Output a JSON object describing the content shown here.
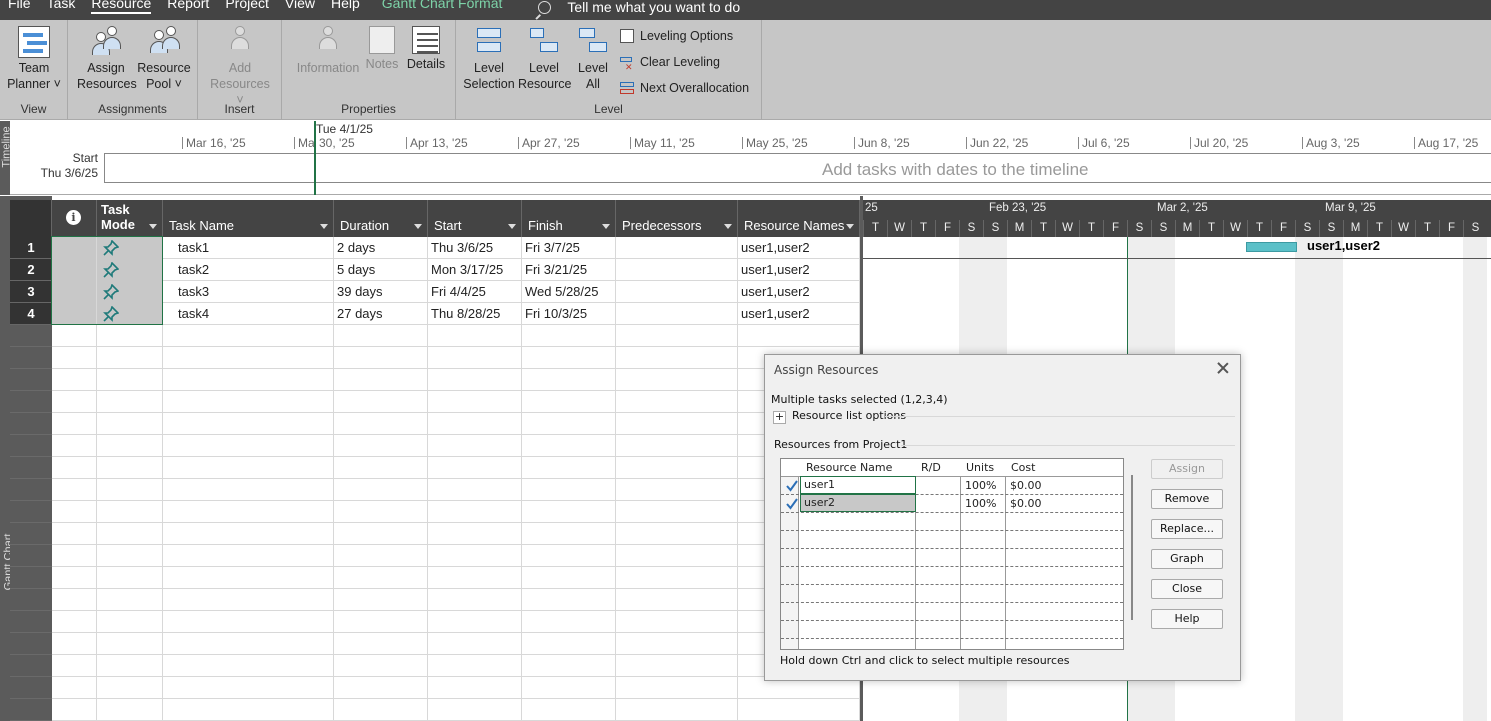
{
  "menu": {
    "tabs": [
      "File",
      "Task",
      "Resource",
      "Report",
      "Project",
      "View",
      "Help"
    ],
    "active": "Resource",
    "contextual_tab": "Gantt Chart Format",
    "search_placeholder": "Tell me what you want to do"
  },
  "ribbon": {
    "groups": {
      "view": "View",
      "assignments": "Assignments",
      "insert": "Insert",
      "properties": "Properties",
      "level": "Level"
    },
    "buttons": {
      "team_planner": [
        "Team",
        "Planner ˅"
      ],
      "assign_resources": [
        "Assign",
        "Resources"
      ],
      "resource_pool": [
        "Resource",
        "Pool ˅"
      ],
      "add_resources": [
        "Add",
        "Resources ˅"
      ],
      "information": "Information",
      "notes": "Notes",
      "details": "Details",
      "level_selection": [
        "Level",
        "Selection"
      ],
      "level_resource": [
        "Level",
        "Resource"
      ],
      "level_all": [
        "Level",
        "All"
      ],
      "leveling_options": "Leveling Options",
      "clear_leveling": "Clear Leveling",
      "next_overallocation": "Next Overallocation"
    }
  },
  "timeline": {
    "side_label": "Timeline",
    "start_label": "Start",
    "start_date": "Thu 3/6/25",
    "today_label": "Tue 4/1/25",
    "placeholder": "Add tasks with dates to the timeline",
    "dates": [
      "Mar 16, '25",
      "Ma",
      "30, '25",
      "Apr 13, '25",
      "Apr 27, '25",
      "May 11, '25",
      "May 25, '25",
      "Jun 8, '25",
      "Jun 22, '25",
      "Jul 6, '25",
      "Jul 20, '25",
      "Aug 3, '25",
      "Aug 17, '25"
    ]
  },
  "grid": {
    "side_label": "Gantt Chart",
    "headers": {
      "task_mode": [
        "Task",
        "Mode"
      ],
      "task_name": "Task Name",
      "duration": "Duration",
      "start": "Start",
      "finish": "Finish",
      "predecessors": "Predecessors",
      "resource_names": "Resource Names"
    },
    "rows": [
      {
        "id": "1",
        "name": "task1",
        "duration": "2 days",
        "start": "Thu 3/6/25",
        "finish": "Fri 3/7/25",
        "predecessors": "",
        "resources": "user1,user2"
      },
      {
        "id": "2",
        "name": "task2",
        "duration": "5 days",
        "start": "Mon 3/17/25",
        "finish": "Fri 3/21/25",
        "predecessors": "",
        "resources": "user1,user2"
      },
      {
        "id": "3",
        "name": "task3",
        "duration": "39 days",
        "start": "Fri 4/4/25",
        "finish": "Wed 5/28/25",
        "predecessors": "",
        "resources": "user1,user2"
      },
      {
        "id": "4",
        "name": "task4",
        "duration": "27 days",
        "start": "Thu 8/28/25",
        "finish": "Fri 10/3/25",
        "predecessors": "",
        "resources": "user1,user2"
      }
    ]
  },
  "gantt": {
    "weeks": [
      "25",
      "Feb 23, '25",
      "Mar 2, '25",
      "Mar 9, '25"
    ],
    "days": [
      "T",
      "W",
      "T",
      "F",
      "S",
      "S",
      "M",
      "T",
      "W",
      "T",
      "F",
      "S",
      "S",
      "M",
      "T",
      "W",
      "T",
      "F",
      "S",
      "S",
      "M",
      "T",
      "W",
      "T",
      "F",
      "S"
    ],
    "bar_label": "user1,user2",
    "colors": {
      "bar": "#5bc0c8",
      "today": "#217346"
    }
  },
  "dialog": {
    "title": "Assign Resources",
    "selection_text": "Multiple tasks selected (1,2,3,4)",
    "list_options": "Resource list options",
    "resources_from": "Resources from Project1",
    "table_headers": {
      "name": "Resource Name",
      "rd": "R/D",
      "units": "Units",
      "cost": "Cost"
    },
    "resources": [
      {
        "name": "user1",
        "rd": "",
        "units": "100%",
        "cost": "$0.00",
        "checked": true
      },
      {
        "name": "user2",
        "rd": "",
        "units": "100%",
        "cost": "$0.00",
        "checked": true
      }
    ],
    "buttons": {
      "assign": "Assign",
      "remove": "Remove",
      "replace": "Replace...",
      "graph": "Graph",
      "close": "Close",
      "help": "Help"
    },
    "hint": "Hold down Ctrl and click to select multiple resources"
  }
}
